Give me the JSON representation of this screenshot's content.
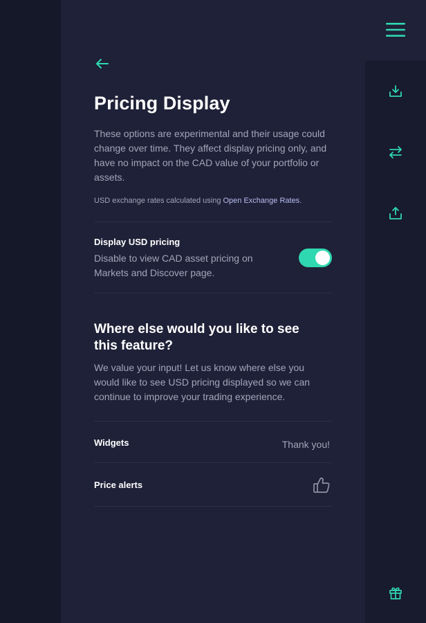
{
  "colors": {
    "accent": "#2fd8b0",
    "panel": "#1f2138",
    "rail": "#181a2d",
    "text_primary": "#ffffff",
    "text_secondary": "#a2a5ba",
    "link": "#b9bdf0"
  },
  "header": {
    "menu_icon": "hamburger-menu-icon",
    "back_icon": "arrow-left-icon",
    "title": "Pricing Display"
  },
  "intro": {
    "text": "These options are experimental and their usage could change over time. They affect display pricing only, and have no impact on the CAD value of your portfolio or assets.",
    "rates_prefix": "USD exchange rates calculated using ",
    "rates_link": "Open Exchange Rates",
    "rates_suffix": "."
  },
  "setting": {
    "title": "Display USD pricing",
    "description": "Disable to view CAD asset pricing on Markets and Discover page.",
    "enabled": true
  },
  "feedback": {
    "title": "Where else would you like to see this feature?",
    "description": "We value your input! Let us know where else you would like to see USD pricing displayed so we can continue to improve your trading experience.",
    "items": [
      {
        "label": "Widgets",
        "status": "Thank you!"
      },
      {
        "label": "Price alerts",
        "icon": "thumbs-up-icon"
      }
    ]
  },
  "rail": {
    "actions": [
      {
        "icon": "download-icon"
      },
      {
        "icon": "transfer-arrows-icon"
      },
      {
        "icon": "upload-icon"
      },
      {
        "icon": "gift-icon"
      }
    ]
  }
}
